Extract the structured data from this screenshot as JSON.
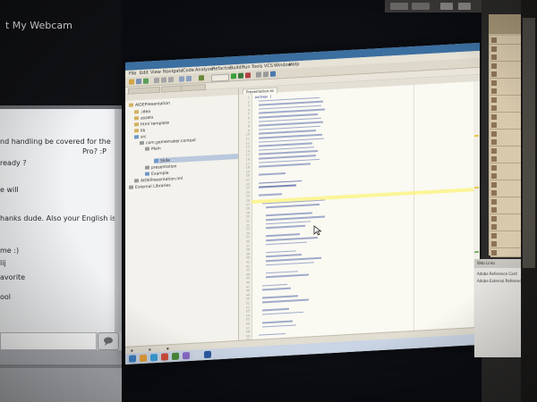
{
  "left_panel": {
    "title": "t My Webcam",
    "chat_lines": [
      "nd handling be covered for the",
      "Pro? :P",
      "ready ?",
      "e will",
      "hanks dude. Also your English is ok",
      "me :)",
      "lij",
      "avorite",
      "ool"
    ]
  },
  "ide": {
    "menu": [
      "File",
      "Edit",
      "View",
      "Navigate",
      "Code",
      "Analyze",
      "Refactor",
      "Build",
      "Run",
      "Tools",
      "VCS",
      "Window",
      "Help"
    ],
    "tree": [
      {
        "label": "AIDEPresentation",
        "indent": 0,
        "kind": "folder"
      },
      {
        "label": ".idea",
        "indent": 1,
        "kind": "folder"
      },
      {
        "label": "assets",
        "indent": 1,
        "kind": "folder"
      },
      {
        "label": "html template",
        "indent": 1,
        "kind": "folder"
      },
      {
        "label": "lib",
        "indent": 1,
        "kind": "folder"
      },
      {
        "label": "src",
        "indent": 1,
        "kind": "folder"
      },
      {
        "label": "com.gamemaker.context",
        "indent": 2,
        "kind": "package"
      },
      {
        "label": "Main",
        "indent": 3,
        "kind": "package"
      },
      {
        "label": "Slide",
        "indent": 4,
        "kind": "file"
      },
      {
        "label": "presentation",
        "indent": 3,
        "kind": "package"
      },
      {
        "label": "Example",
        "indent": 3,
        "kind": "file"
      },
      {
        "label": "AIDEPresentation.iml",
        "indent": 1,
        "kind": "file"
      },
      {
        "label": "External Libraries",
        "indent": 0,
        "kind": "lib"
      }
    ],
    "tab": "Presentation.as",
    "code_first": "package {",
    "line_numbers": [
      "1",
      "2",
      "3",
      "4",
      "5",
      "6",
      "7",
      "8",
      "9",
      "10",
      "11",
      "12",
      "13",
      "14",
      "15",
      "16",
      "17",
      "18",
      "19",
      "20",
      "21",
      "22",
      "23",
      "24",
      "25",
      "26",
      "27",
      "28",
      "29",
      "30",
      "31",
      "32",
      "33",
      "34",
      "35",
      "36",
      "37",
      "38",
      "39",
      "40",
      "41",
      "42",
      "43",
      "44",
      "45",
      "46",
      "47",
      "48",
      "49",
      "50",
      "51",
      "52",
      "53",
      "54",
      "55",
      "56",
      "57",
      "58",
      "59",
      "60"
    ]
  },
  "right_panel": {
    "bottom_lines": [
      "Web Links",
      "Adobe Reference Card",
      "Adobe External Reference"
    ]
  },
  "colors": {
    "ide_title": "#3b6fa0",
    "editor_bg": "#faf9f2",
    "highlight": "#fbf37a",
    "right_list": "#c8b99e"
  }
}
